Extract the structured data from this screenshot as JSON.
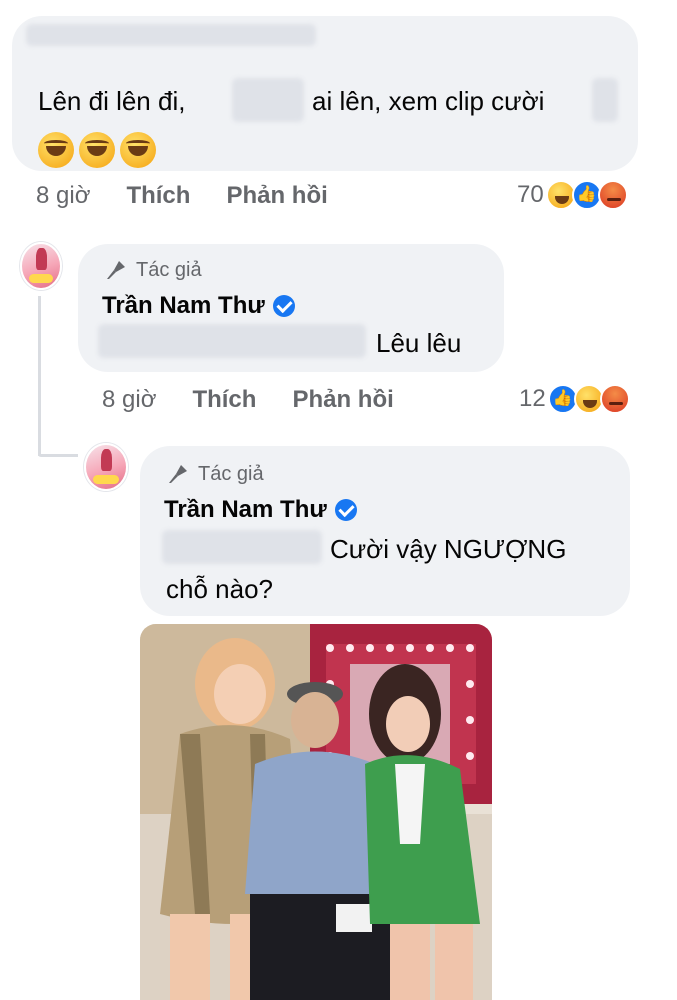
{
  "comment1": {
    "text_before": "Lên đi lên đi,",
    "text_after": "ai lên, xem clip cười",
    "emojis": [
      "rofl-emoji",
      "rofl-emoji",
      "rofl-emoji"
    ],
    "time": "8 giờ",
    "like_label": "Thích",
    "reply_label": "Phản hồi",
    "reaction_count": "70",
    "reactions": [
      "haha",
      "like",
      "angry"
    ]
  },
  "reply1": {
    "author_tag": "Tác giả",
    "name": "Trần Nam Thư",
    "text": "Lêu lêu",
    "time": "8 giờ",
    "like_label": "Thích",
    "reply_label": "Phản hồi",
    "reaction_count": "12",
    "reactions": [
      "like",
      "haha",
      "angry"
    ]
  },
  "reply2": {
    "author_tag": "Tác giả",
    "name": "Trần Nam Thư",
    "text_line1": "Cười vậy NGƯỢNG",
    "text_line2": "chỗ nào?"
  },
  "colors": {
    "bubble": "#f0f2f5",
    "meta": "#65676b",
    "like_blue": "#1877f2",
    "text": "#050505"
  }
}
